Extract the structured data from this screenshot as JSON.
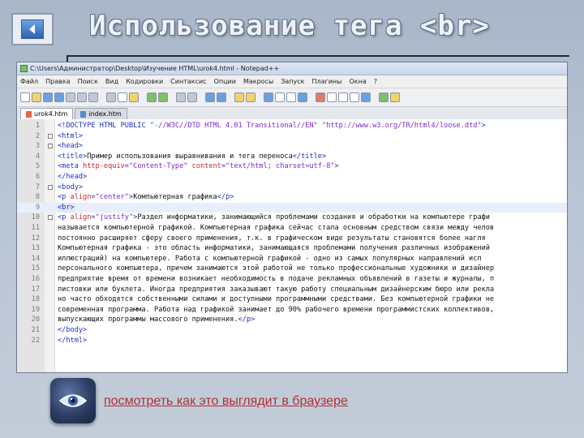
{
  "slide": {
    "title": "Использование тега <br>",
    "link_text": "посмотреть как это выглядит в браузере"
  },
  "window": {
    "title": "C:\\Users\\Администратор\\Desktop\\Изучение HTML\\urok4.html - Notepad++",
    "menu": [
      "Файл",
      "Правка",
      "Поиск",
      "Вид",
      "Кодировки",
      "Синтаксис",
      "Опции",
      "Макросы",
      "Запуск",
      "Плагины",
      "Окна",
      "?"
    ],
    "tabs": [
      {
        "label": "urok4.htm",
        "active": true
      },
      {
        "label": "index.htm",
        "active": false
      }
    ]
  },
  "code": {
    "lines": [
      [
        {
          "t": "tag",
          "v": "<!DOCTYPE HTML PUBLIC "
        },
        {
          "t": "str",
          "v": "\"-//W3C//DTD HTML 4.01 Transitional//EN\""
        },
        {
          "t": "tag",
          "v": " "
        },
        {
          "t": "str",
          "v": "\"http://www.w3.org/TR/html4/loose.dtd\""
        },
        {
          "t": "tag",
          "v": ">"
        }
      ],
      [
        {
          "t": "tag",
          "v": "<html>"
        }
      ],
      [
        {
          "t": "tag",
          "v": "<head>"
        }
      ],
      [
        {
          "t": "tag",
          "v": "<title>"
        },
        {
          "t": "txt",
          "v": "Пример использования выравнивания и тега переноса"
        },
        {
          "t": "tag",
          "v": "</title>"
        }
      ],
      [
        {
          "t": "tag",
          "v": "<meta "
        },
        {
          "t": "attr",
          "v": "http-equiv"
        },
        {
          "t": "tag",
          "v": "="
        },
        {
          "t": "str",
          "v": "\"Content-Type\""
        },
        {
          "t": "tag",
          "v": " "
        },
        {
          "t": "attr",
          "v": "content"
        },
        {
          "t": "tag",
          "v": "="
        },
        {
          "t": "str",
          "v": "\"text/html; charset=utf-8\""
        },
        {
          "t": "tag",
          "v": ">"
        }
      ],
      [
        {
          "t": "tag",
          "v": "</head>"
        }
      ],
      [
        {
          "t": "tag",
          "v": "<body>"
        }
      ],
      [
        {
          "t": "tag",
          "v": "<p "
        },
        {
          "t": "attr",
          "v": "align"
        },
        {
          "t": "tag",
          "v": "="
        },
        {
          "t": "str",
          "v": "\"center\""
        },
        {
          "t": "tag",
          "v": ">"
        },
        {
          "t": "txt",
          "v": "Компьютерная графика"
        },
        {
          "t": "tag",
          "v": "</p>"
        }
      ],
      [
        {
          "t": "tag",
          "v": "<br>"
        }
      ],
      [
        {
          "t": "tag",
          "v": "<p "
        },
        {
          "t": "attr",
          "v": "align"
        },
        {
          "t": "tag",
          "v": "="
        },
        {
          "t": "str",
          "v": "\"justify\""
        },
        {
          "t": "tag",
          "v": ">"
        },
        {
          "t": "txt",
          "v": "Раздел информатики, занимающийся проблемами создания и обработки на компьютере графи"
        }
      ],
      [
        {
          "t": "txt",
          "v": "называется компьютерной графикой. Компьютерная графика сейчас стала основным средством связи между челов"
        }
      ],
      [
        {
          "t": "txt",
          "v": "постоянно расширяет сферу своего применения, т.к. в графическом виде результаты становятся более нагля"
        }
      ],
      [
        {
          "t": "txt",
          "v": "Компьютерная графика - это область информатики, занимающаяся проблемами получения различных изображений"
        }
      ],
      [
        {
          "t": "txt",
          "v": "иллюстраций) на компьютере. Работа с компьютерной графикой - одно из самых популярных направлений исп"
        }
      ],
      [
        {
          "t": "txt",
          "v": "персонального компьютера, причем занимаются этой работой не только профессиональные художники и дизайнер"
        }
      ],
      [
        {
          "t": "txt",
          "v": "предприятие время от времени возникает необходимость в подаче рекламных объявлений в газеты и журналы, п"
        }
      ],
      [
        {
          "t": "txt",
          "v": "листовки или буклета. Иногда предприятия заказывают такую работу специальным дизайнерским бюро или рекла"
        }
      ],
      [
        {
          "t": "txt",
          "v": "но часто обходятся собственными силами и доступными программными средствами. Без компьютерной графики не"
        }
      ],
      [
        {
          "t": "txt",
          "v": "современная программа. Работа над графикой занимает до 90% рабочего времени программистских коллективов,"
        }
      ],
      [
        {
          "t": "txt",
          "v": "выпускающих программы массового применения."
        },
        {
          "t": "tag",
          "v": "</p>"
        }
      ],
      [
        {
          "t": "tag",
          "v": "</body>"
        }
      ],
      [
        {
          "t": "tag",
          "v": "</html>"
        }
      ]
    ]
  }
}
